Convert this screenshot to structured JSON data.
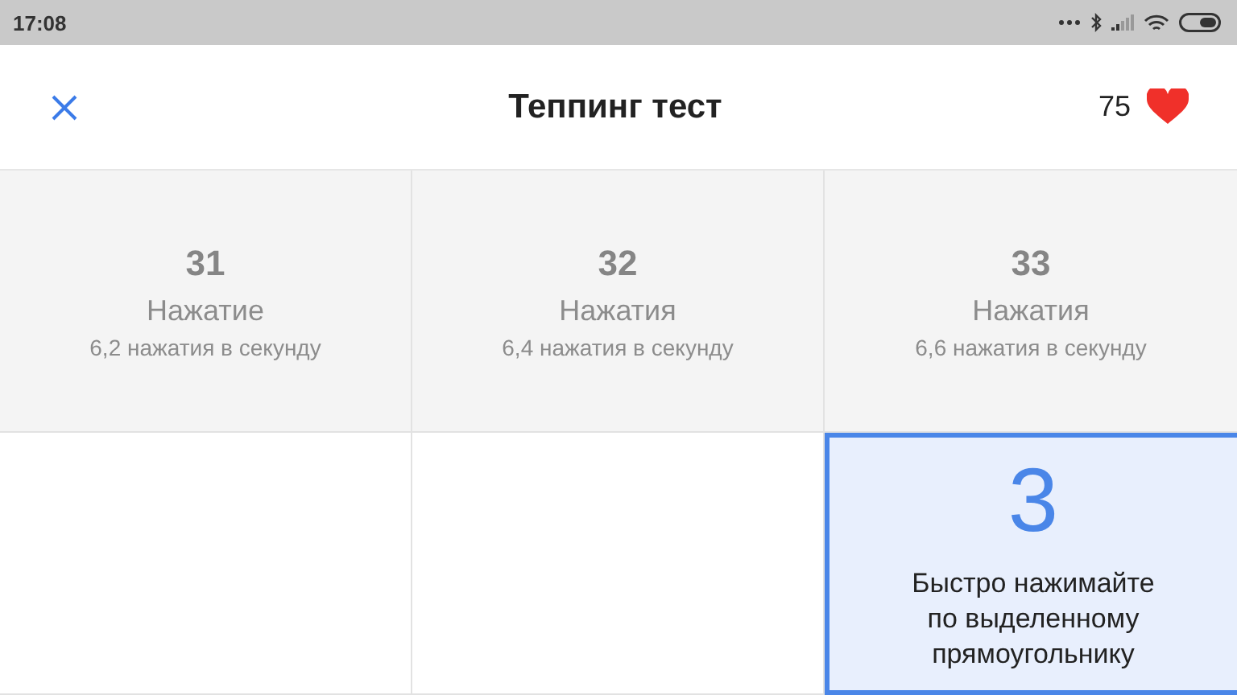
{
  "status_bar": {
    "time": "17:08"
  },
  "header": {
    "title": "Теппинг тест",
    "score": "75"
  },
  "cells": [
    {
      "kind": "result",
      "count": "31",
      "label": "Нажатие",
      "rate": "6,2 нажатия в секунду"
    },
    {
      "kind": "result",
      "count": "32",
      "label": "Нажатия",
      "rate": "6,4 нажатия в секунду"
    },
    {
      "kind": "result",
      "count": "33",
      "label": "Нажатия",
      "rate": "6,6 нажатия в секунду"
    },
    {
      "kind": "empty"
    },
    {
      "kind": "empty"
    },
    {
      "kind": "target",
      "count": "3",
      "instruction": "Быстро нажимайте по выделенному прямоугольнику"
    }
  ]
}
